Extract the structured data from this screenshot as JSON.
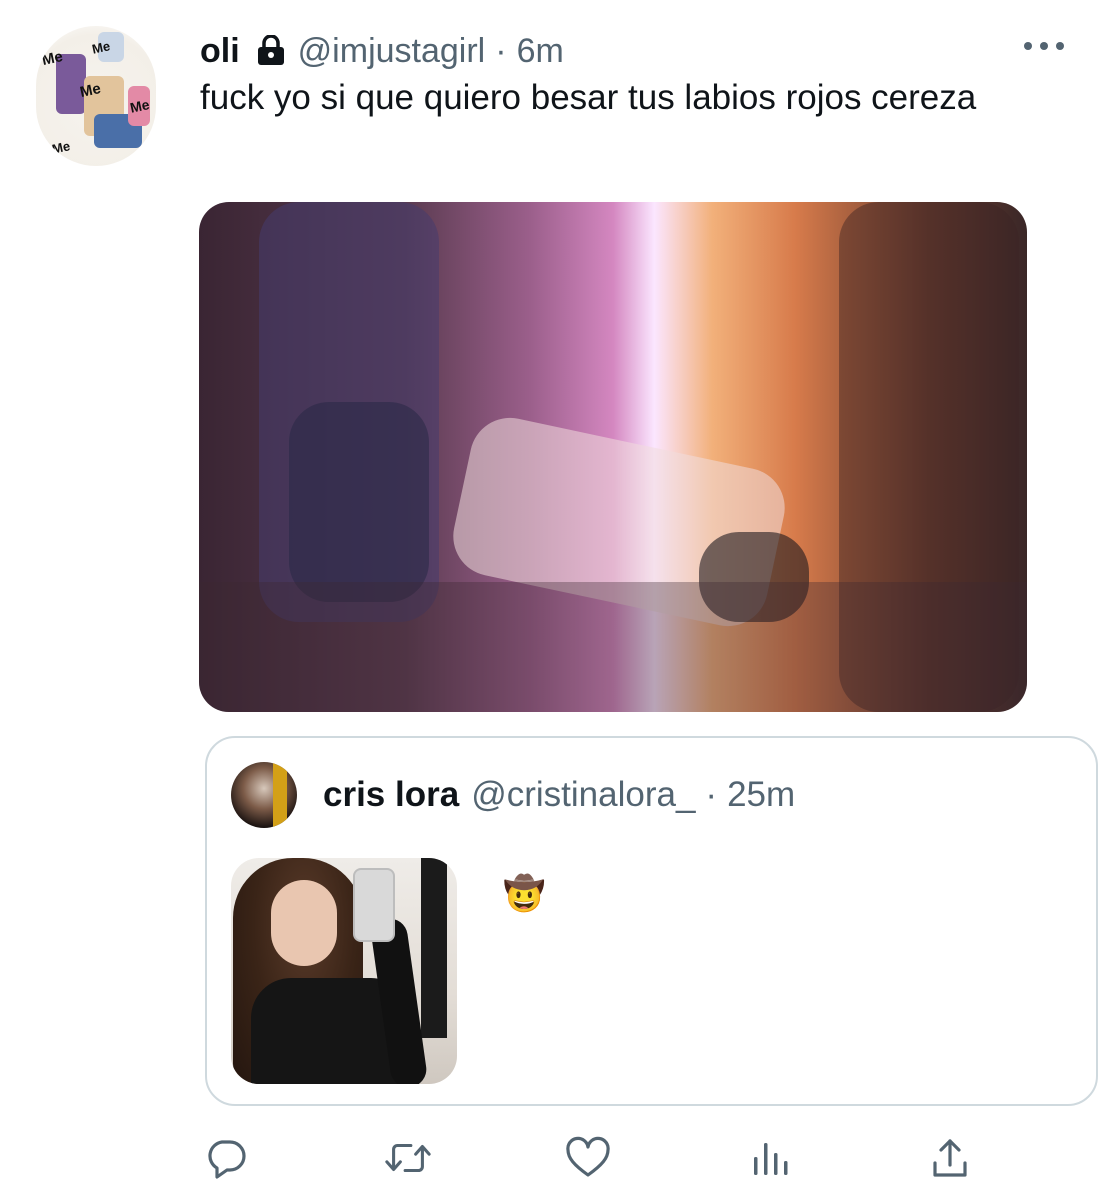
{
  "tweet": {
    "name": "oli",
    "handle": "@imjustagirl",
    "separator": "·",
    "time": "6m",
    "text": "fuck yo si que quiero besar tus labios rojos cereza",
    "avatar_tags": [
      "Me",
      "Me",
      "Me",
      "Me",
      "Me"
    ]
  },
  "quote": {
    "name": "cris lora",
    "handle": "@cristinalora_",
    "separator": "·",
    "time": "25m",
    "emoji": "🤠"
  },
  "actions": [
    {
      "name": "reply-icon"
    },
    {
      "name": "retweet-icon"
    },
    {
      "name": "like-icon"
    },
    {
      "name": "analytics-icon"
    },
    {
      "name": "share-icon"
    }
  ],
  "colors": {
    "text": "#0f1419",
    "secondary": "#536471",
    "border": "#cfd9de"
  }
}
